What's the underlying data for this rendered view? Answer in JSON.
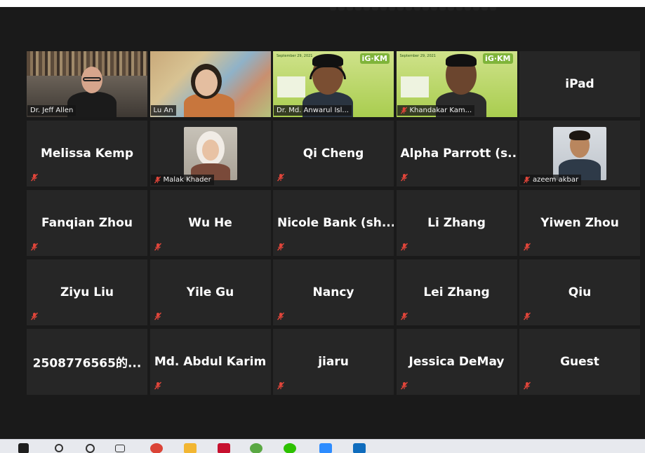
{
  "window": {
    "app": "Zoom meeting gallery view"
  },
  "participants": [
    {
      "name": "Dr. Jeff Allen",
      "video": true,
      "active_speaker": true,
      "muted": false
    },
    {
      "name": "Lu An",
      "video": true,
      "muted": false
    },
    {
      "name": "Dr. Md. Anwarul Isl...",
      "video": true,
      "muted": false
    },
    {
      "name": "Khandakar Kam...",
      "video": true,
      "muted": true
    },
    {
      "name": "iPad",
      "video": false,
      "muted": false
    },
    {
      "name": "Melissa Kemp",
      "video": false,
      "muted": true
    },
    {
      "name": "Malak Khader",
      "video": false,
      "photo": true,
      "muted": true
    },
    {
      "name": "Qi Cheng",
      "video": false,
      "muted": true
    },
    {
      "name": "Alpha Parrott (s...",
      "video": false,
      "muted": true
    },
    {
      "name": "azeem akbar",
      "video": false,
      "photo": true,
      "muted": true
    },
    {
      "name": "Fanqian Zhou",
      "video": false,
      "muted": true
    },
    {
      "name": "Wu He",
      "video": false,
      "muted": true
    },
    {
      "name": "Nicole Bank (sh...",
      "video": false,
      "muted": true
    },
    {
      "name": "Li Zhang",
      "video": false,
      "muted": true
    },
    {
      "name": "Yiwen Zhou",
      "video": false,
      "muted": true
    },
    {
      "name": "Ziyu Liu",
      "video": false,
      "muted": true
    },
    {
      "name": "Yile Gu",
      "video": false,
      "muted": true
    },
    {
      "name": "Nancy",
      "video": false,
      "muted": true
    },
    {
      "name": "Lei Zhang",
      "video": false,
      "muted": true
    },
    {
      "name": "Qiu",
      "video": false,
      "muted": true
    },
    {
      "name": "2508776565的...",
      "video": false,
      "muted": false
    },
    {
      "name": "Md. Abdul Karim",
      "video": false,
      "muted": true
    },
    {
      "name": "jiaru",
      "video": false,
      "muted": true
    },
    {
      "name": "Jessica DeMay",
      "video": false,
      "muted": true
    },
    {
      "name": "Guest",
      "video": false,
      "muted": true
    }
  ],
  "banner": {
    "date": "September 29, 2021",
    "logo": "iG·KM"
  },
  "colors": {
    "active_outline": "#d7e33c",
    "mute_icon": "#e0453a",
    "tile_bg": "#262626",
    "background": "#1a1a1a"
  },
  "taskbar_icons": [
    "windows-icon",
    "search-icon",
    "cortana-icon",
    "task-view-icon",
    "chrome-icon",
    "file-explorer-icon",
    "acrobat-icon",
    "app-icon",
    "wechat-icon",
    "zoom-icon",
    "outlook-icon"
  ]
}
